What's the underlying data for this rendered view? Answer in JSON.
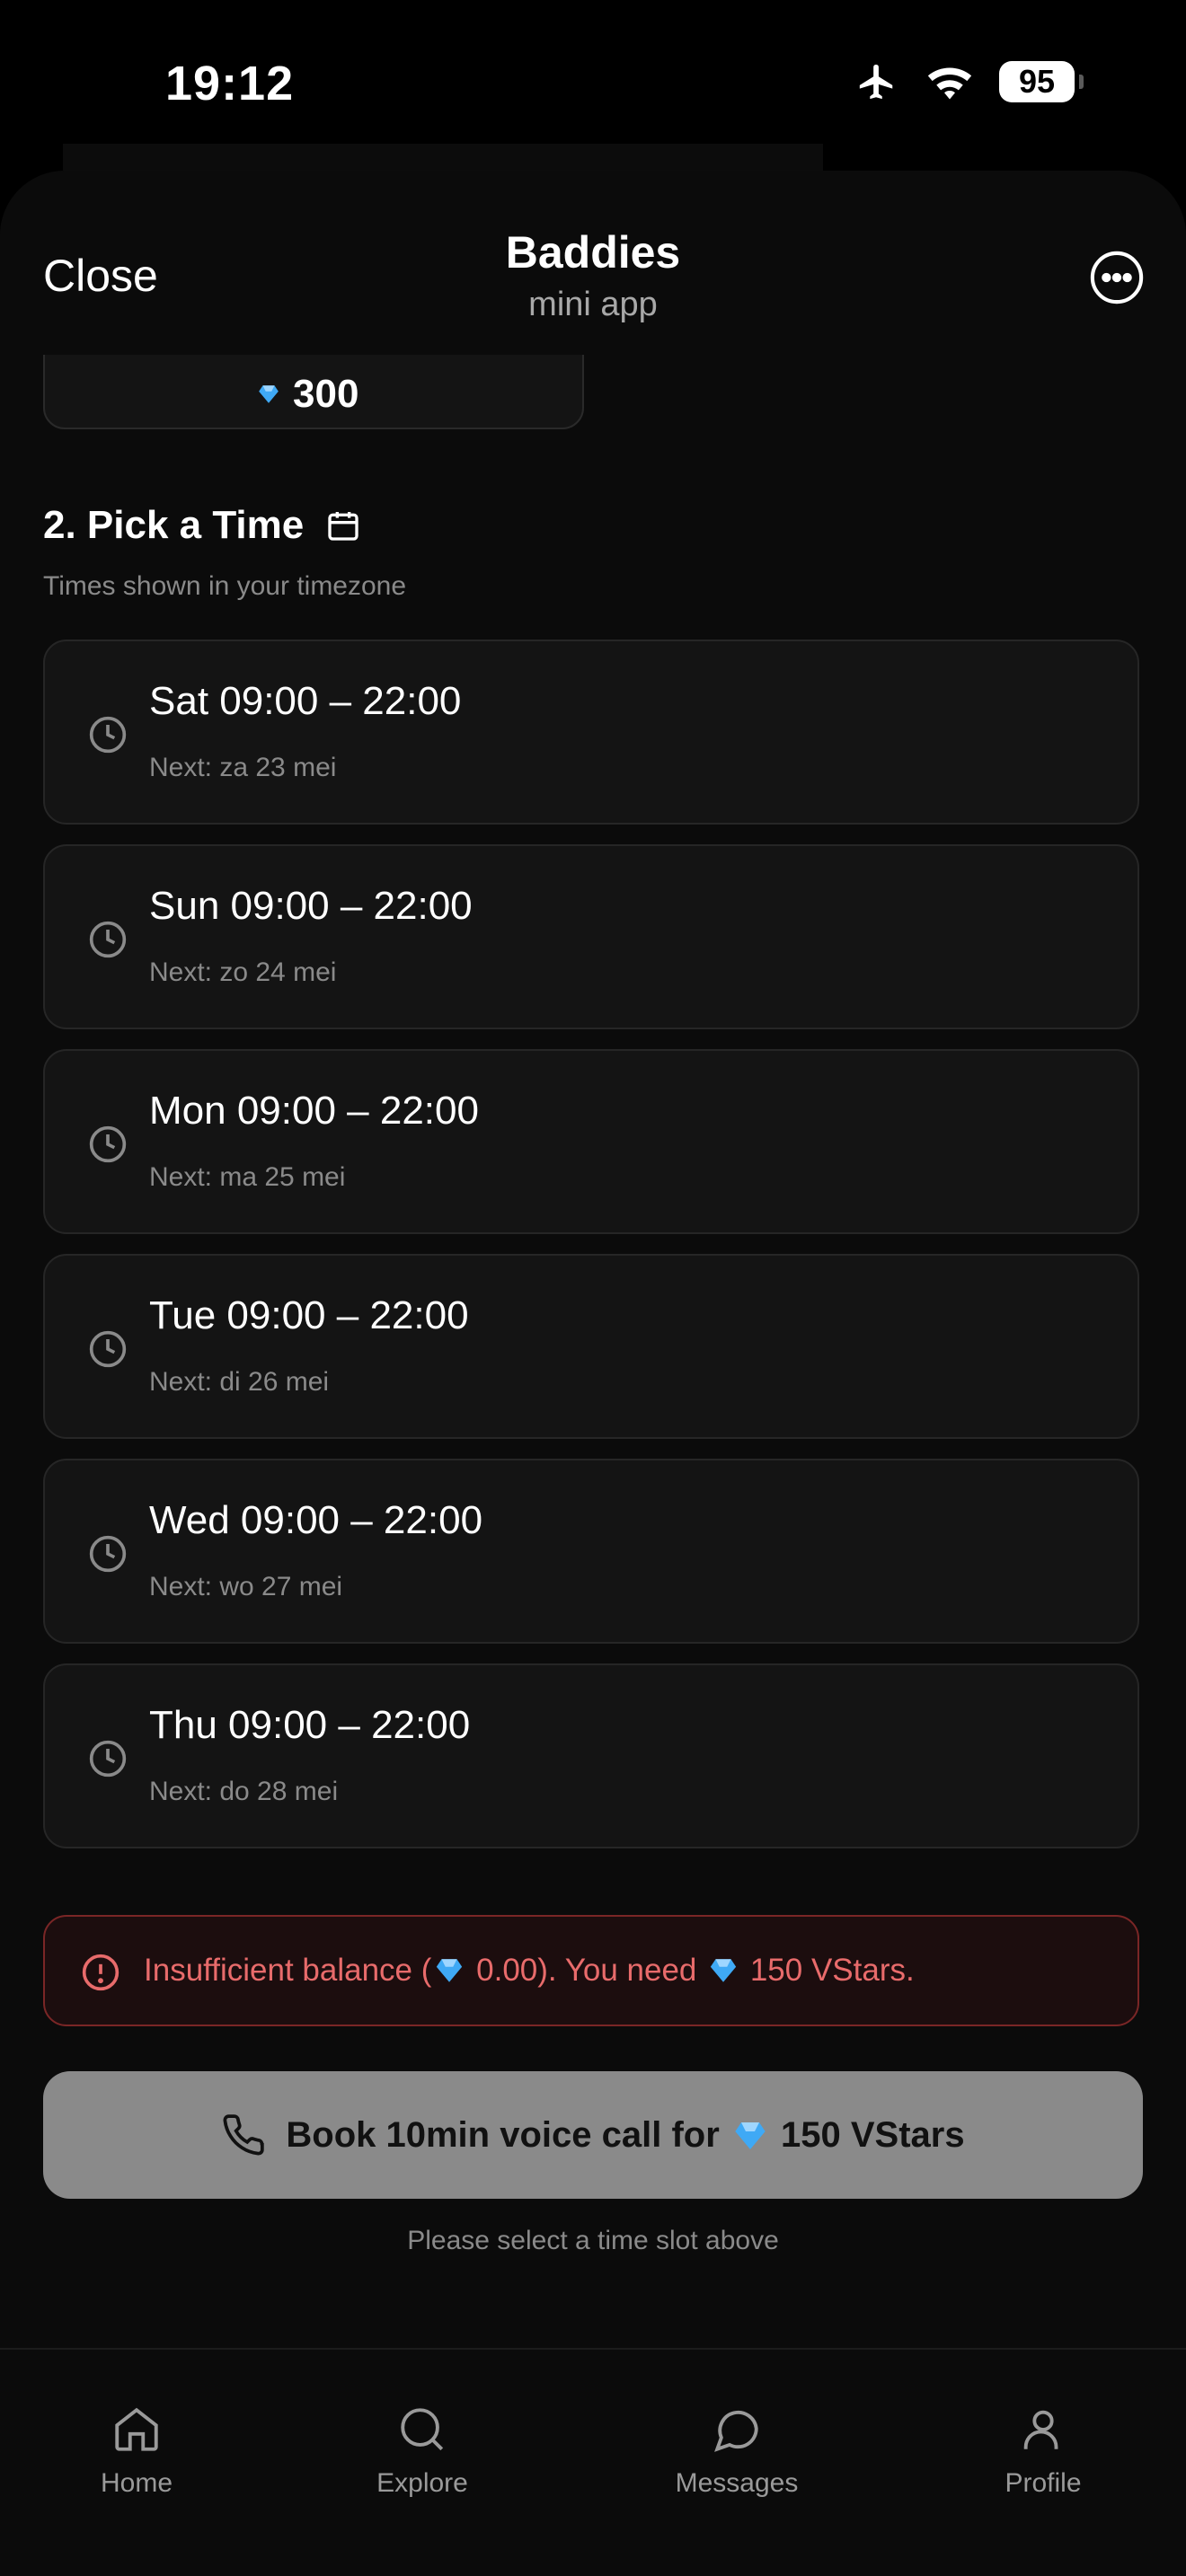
{
  "status_bar": {
    "time": "19:12",
    "battery": "95"
  },
  "header": {
    "close_label": "Close",
    "title": "Baddies",
    "subtitle": "mini app"
  },
  "price_card": {
    "value": "300"
  },
  "section": {
    "title": "2. Pick a Time",
    "subtitle": "Times shown in your timezone"
  },
  "slots": [
    {
      "label": "Sat 09:00 – 22:00",
      "next": "Next: za 23 mei"
    },
    {
      "label": "Sun 09:00 – 22:00",
      "next": "Next: zo 24 mei"
    },
    {
      "label": "Mon 09:00 – 22:00",
      "next": "Next: ma 25 mei"
    },
    {
      "label": "Tue 09:00 – 22:00",
      "next": "Next: di 26 mei"
    },
    {
      "label": "Wed 09:00 – 22:00",
      "next": "Next: wo 27 mei"
    },
    {
      "label": "Thu 09:00 – 22:00",
      "next": "Next: do 28 mei"
    }
  ],
  "alert": {
    "part1": "Insufficient balance (",
    "balance": "0.00",
    "part2": "). You need",
    "required": "150 VStars."
  },
  "book_button": {
    "prefix": "Book 10min voice call for",
    "amount": "150 VStars"
  },
  "hint": "Please select a time slot above",
  "nav": {
    "home": "Home",
    "explore": "Explore",
    "messages": "Messages",
    "profile": "Profile"
  },
  "colors": {
    "accent_error": "#e86b6b",
    "gem": "#3fa9f5",
    "button_disabled": "#8a8a8a"
  }
}
